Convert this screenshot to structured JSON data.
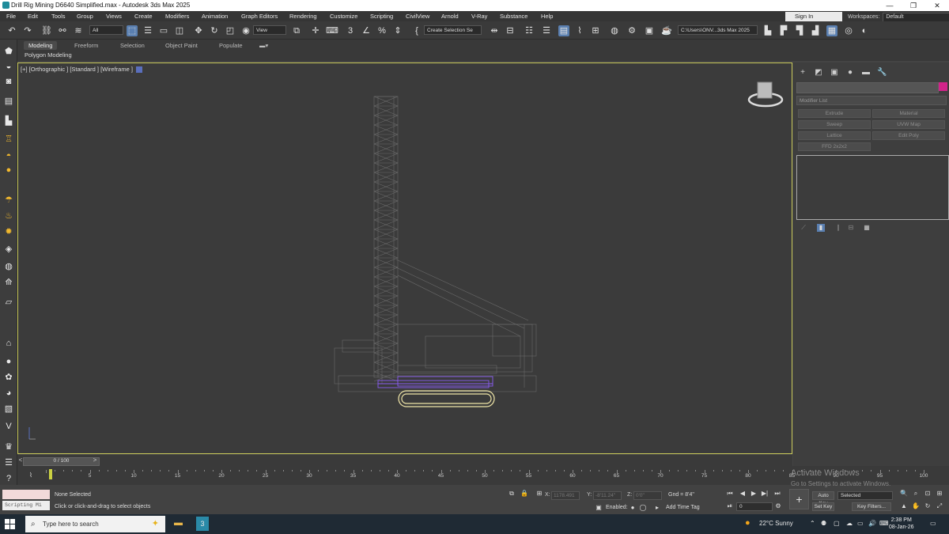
{
  "window": {
    "title": "Drill Rig Mining D6640 Simplified.max - Autodesk 3ds Max 2025"
  },
  "menu": {
    "items": [
      "File",
      "Edit",
      "Tools",
      "Group",
      "Views",
      "Create",
      "Modifiers",
      "Animation",
      "Graph Editors",
      "Rendering",
      "Customize",
      "Scripting",
      "CivilView",
      "Arnold",
      "V-Ray",
      "Substance",
      "Help"
    ],
    "sign_in": "Sign In",
    "workspaces_label": "Workspaces:",
    "workspaces_value": "Default"
  },
  "toolbar": {
    "selection_filter": "All",
    "reference_coord": "View",
    "named_selection": "Create Selection Se",
    "project_path": "C:\\Users\\ONV...3ds Max 2025"
  },
  "ribbon": {
    "tabs": [
      "Modeling",
      "Freeform",
      "Selection",
      "Object Paint",
      "Populate"
    ],
    "active_tab": "Modeling",
    "panel_label": "Polygon Modeling"
  },
  "viewport": {
    "label": "[+] [Orthographic ] [Standard ] [Wireframe ]",
    "selection_color": "#8a5cf2",
    "highlight_color": "#f0e6a8"
  },
  "command_panel": {
    "modifier_list": "Modifier List",
    "buttons": [
      "Extrude",
      "Material",
      "Sweep",
      "UVW Map",
      "Lattice",
      "Edit Poly",
      "FFD 2x2x2"
    ],
    "color_swatch": "#d2248a"
  },
  "time_slider": {
    "label": "0 / 100"
  },
  "track_bar": {
    "ticks": [
      0,
      5,
      10,
      15,
      20,
      25,
      30,
      35,
      40,
      45,
      50,
      55,
      60,
      65,
      70,
      75,
      80,
      85,
      90,
      95,
      100
    ],
    "max": 100
  },
  "status": {
    "scripting_label": "Scripting Mi",
    "selection": "None Selected",
    "prompt": "Click or click-and-drag to select objects",
    "x_label": "X:",
    "x_value": "1178.491",
    "y_label": "Y:",
    "y_value": "-8'11.24\"",
    "z_label": "Z:",
    "z_value": "0'0\"",
    "grid": "Gnd = 8'4\"",
    "enabled_label": "Enabled:",
    "add_time_tag": "Add Time Tag",
    "auto_key": "Auto Key",
    "set_key": "Set Key",
    "key_mode": "Selected",
    "key_filters": "Key Filters...",
    "current_frame": "0"
  },
  "watermark": {
    "line1": "Activate Windows",
    "line2": "Go to Settings to activate Windows."
  },
  "taskbar": {
    "search_placeholder": "Type here to search",
    "weather": "22°C  Sunny",
    "time": "2:38 PM",
    "date": "08-Jan-26"
  }
}
